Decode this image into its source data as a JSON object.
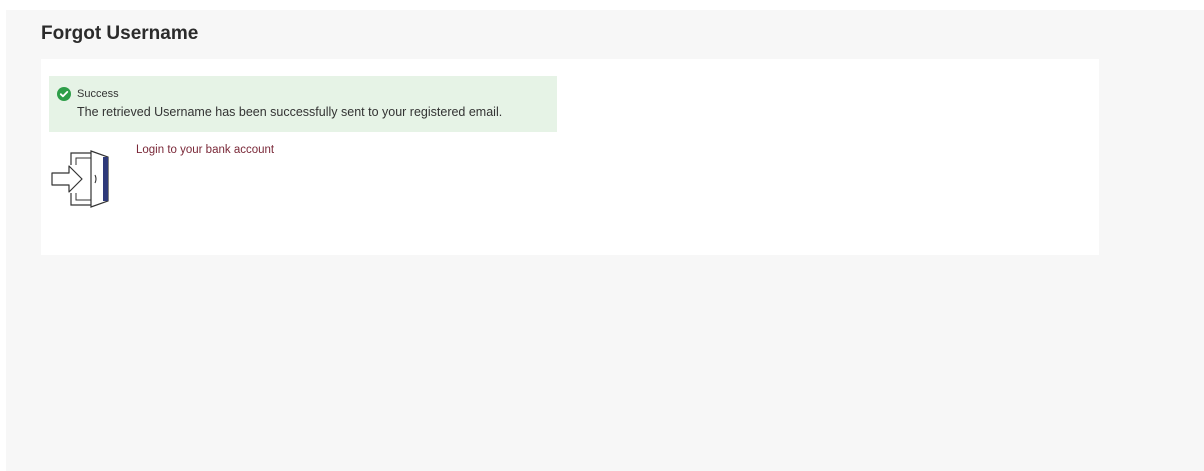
{
  "page": {
    "title": "Forgot Username"
  },
  "alert": {
    "status": "success",
    "icon": "check-circle-icon",
    "title": "Success",
    "message": "The retrieved Username has been successfully sent to your registered email.",
    "color": "#2e9e49",
    "background": "#e6f3e6"
  },
  "login": {
    "icon": "login-door-icon",
    "link_label": "Login to your bank account",
    "link_color": "#7a2838"
  }
}
